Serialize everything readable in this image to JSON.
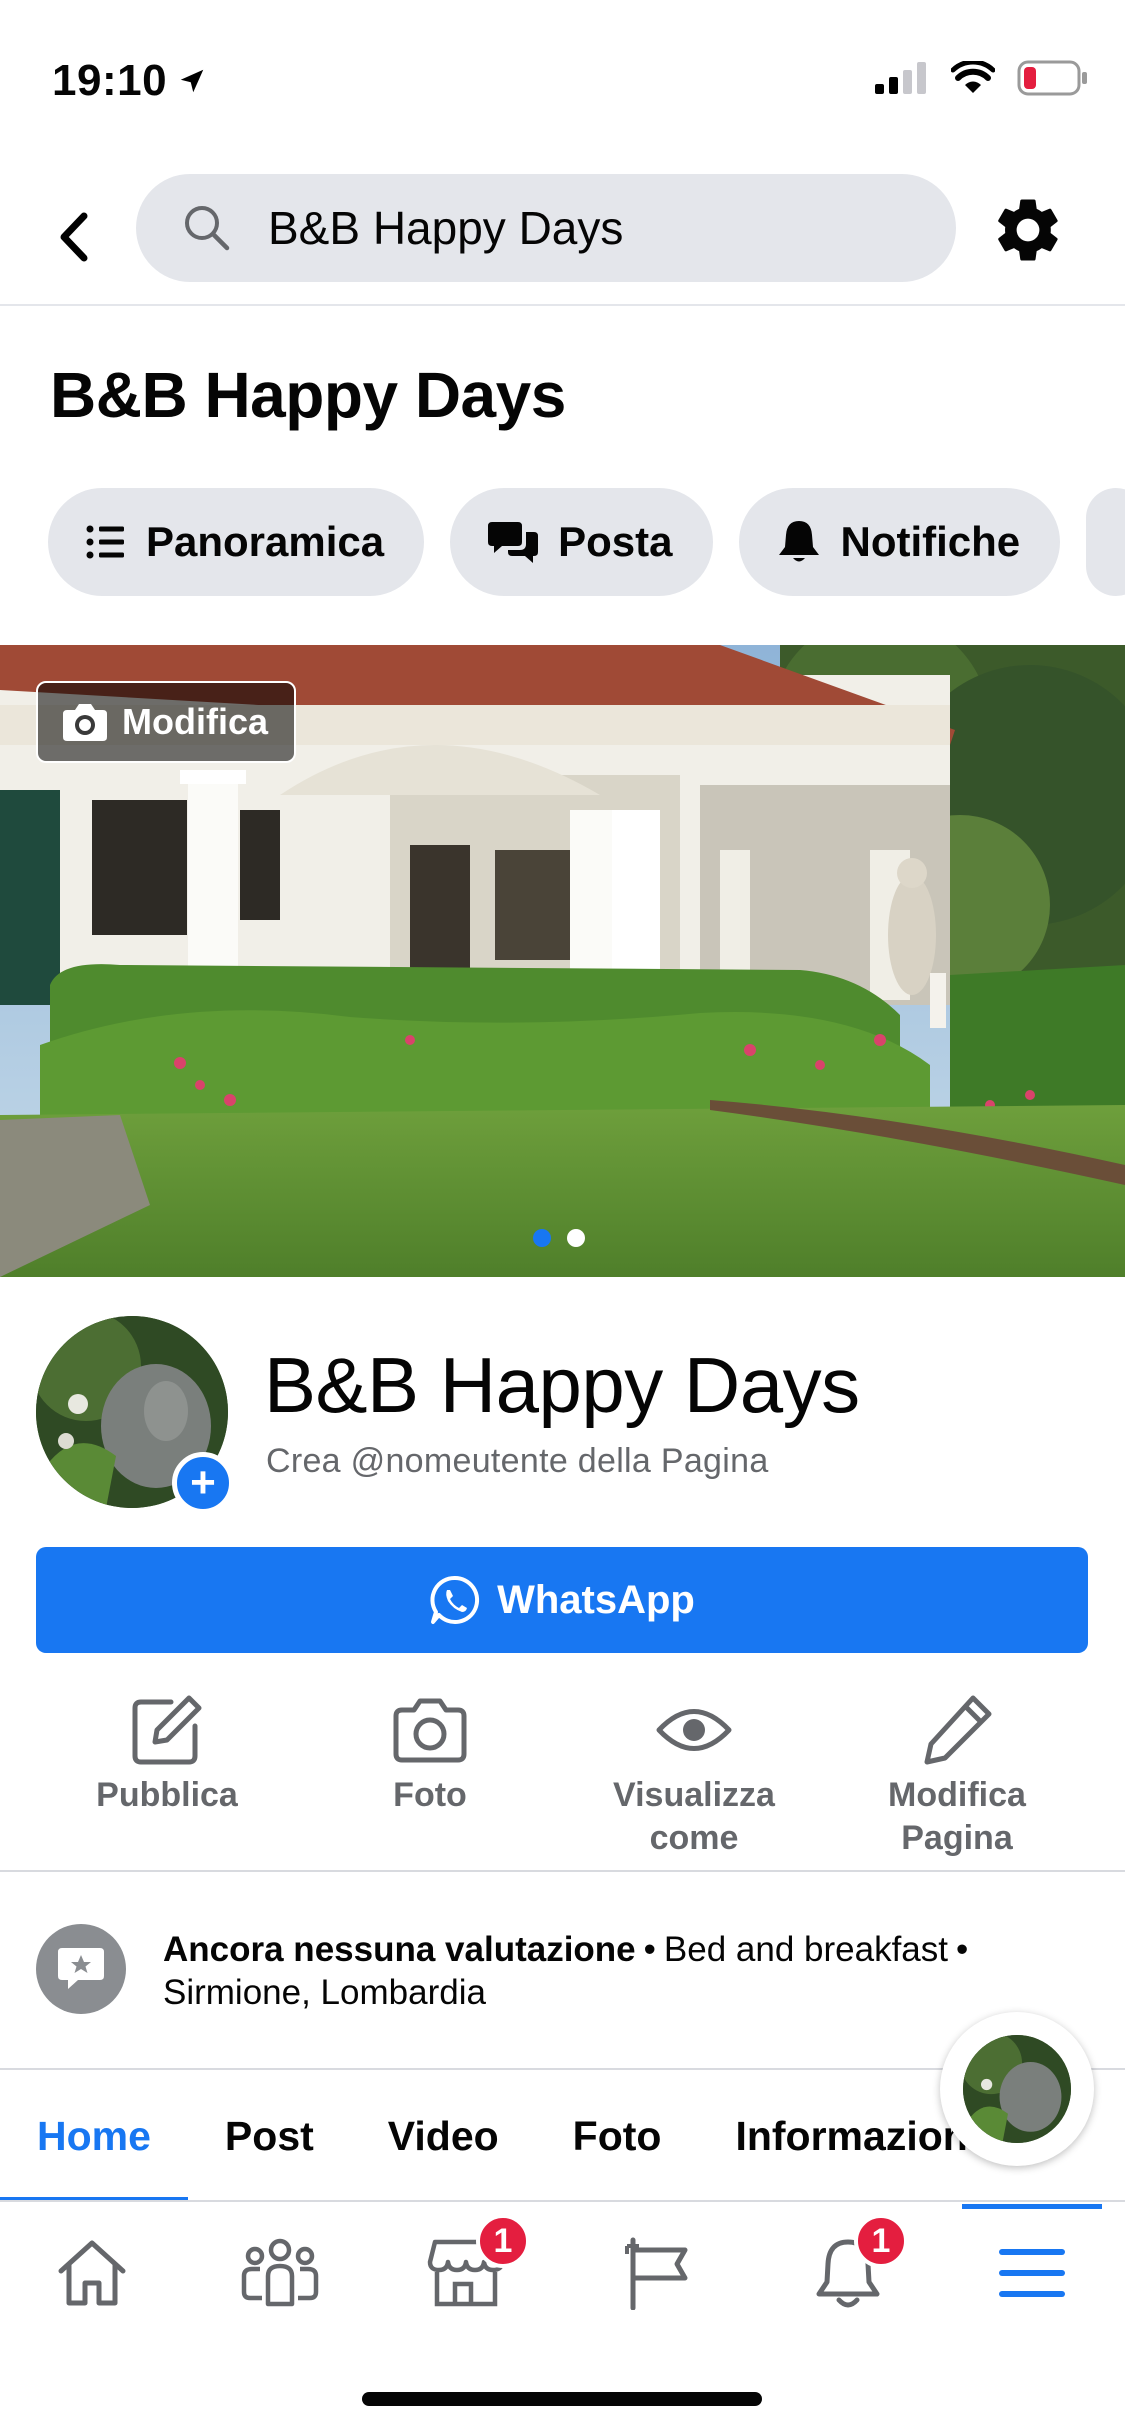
{
  "status_bar": {
    "time": "19:10"
  },
  "search": {
    "query": "B&B Happy Days"
  },
  "page": {
    "title": "B&B Happy Days"
  },
  "chips": [
    {
      "label": "Panoramica",
      "icon": "list-icon"
    },
    {
      "label": "Posta",
      "icon": "chat-bubbles-icon"
    },
    {
      "label": "Notifiche",
      "icon": "bell-icon"
    }
  ],
  "cover": {
    "edit_label": "Modifica",
    "slide_count": 2,
    "active_slide": 1
  },
  "profile": {
    "name": "B&B Happy Days",
    "subtitle": "Crea @nomeutente della Pagina"
  },
  "whatsapp_button": {
    "label": "WhatsApp"
  },
  "actions": {
    "publish": "Pubblica",
    "photo": "Foto",
    "view_as_line1": "Visualizza",
    "view_as_line2": "come",
    "edit_page_line1": "Modifica",
    "edit_page_line2": "Pagina"
  },
  "info": {
    "rating": "Ancora nessuna valutazione",
    "separator": "•",
    "category": "Bed and breakfast",
    "location": "Sirmione, Lombardia"
  },
  "tabs": [
    {
      "label": "Home",
      "active": true
    },
    {
      "label": "Post"
    },
    {
      "label": "Video"
    },
    {
      "label": "Foto"
    },
    {
      "label": "Informazioni"
    }
  ],
  "bottom_nav": {
    "marketplace_badge": "1",
    "notifications_badge": "1"
  },
  "colors": {
    "accent": "#1877f2",
    "badge": "#e41e3f",
    "chip_bg": "#e4e6eb",
    "secondary_text": "#65676b"
  }
}
